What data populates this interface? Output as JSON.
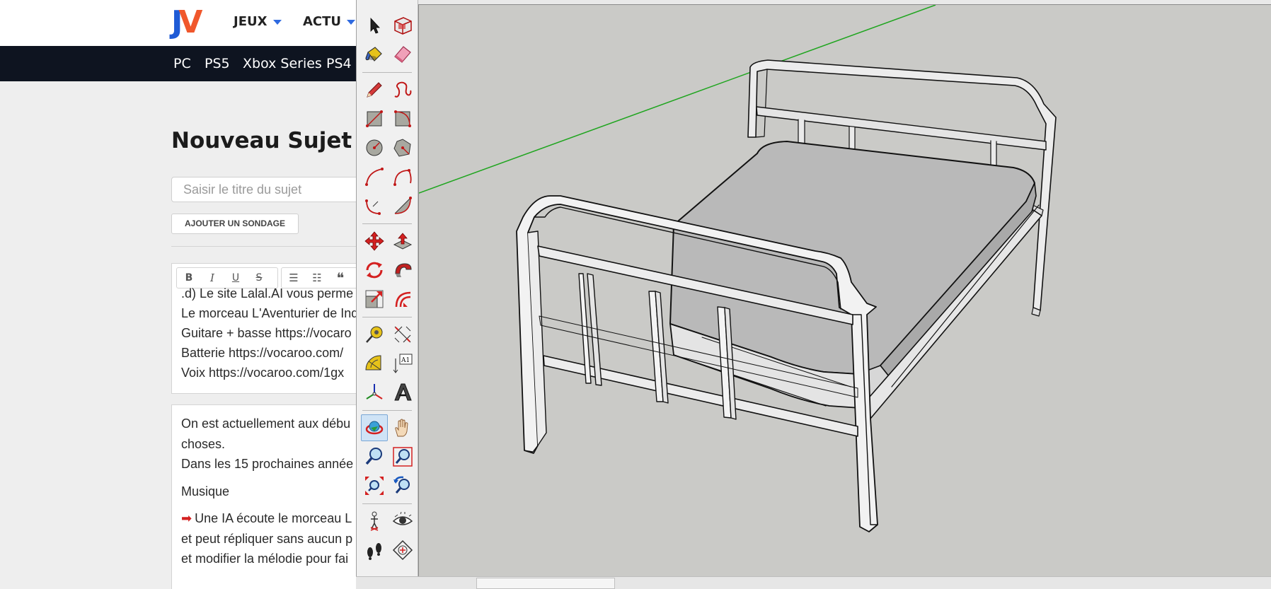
{
  "site": {
    "logo_j": "J",
    "logo_v": "V",
    "menu": [
      {
        "label": "JEUX"
      },
      {
        "label": "ACTU"
      }
    ],
    "platforms": [
      "PC",
      "PS5",
      "Xbox Series",
      "PS4"
    ]
  },
  "form": {
    "page_title": "Nouveau Sujet",
    "title_placeholder": "Saisir le titre du sujet",
    "poll_button": "AJOUTER UN SONDAGE"
  },
  "editor": {
    "toolbar": {
      "bold": "B",
      "italic": "I",
      "underline": "U",
      "strike": "S",
      "bullets": "☰",
      "numbered": "☷",
      "quote": "❝"
    },
    "lines": [
      ".d) Le site Lalal.AI vous perme",
      "Le morceau L'Aventurier de Ind",
      "Guitare + basse https://vocaro",
      "Batterie https://vocaroo.com/",
      "Voix https://vocaroo.com/1gx"
    ]
  },
  "preview": {
    "p1_line1": "On est actuellement aux débu",
    "p1_line2": "choses.",
    "p1_line3": "Dans les 15 prochaines année",
    "heading": "Musique",
    "p2_line1": "Une IA écoute le morceau L",
    "p2_line2": "et peut répliquer sans aucun p",
    "p2_line3": "et modifier la mélodie pour fai"
  },
  "sketchup": {
    "active_tool": "orbit",
    "tools": [
      "select",
      "make-component",
      "paint-bucket",
      "eraser",
      "line",
      "freehand",
      "rectangle",
      "rotated-rectangle",
      "circle",
      "polygon",
      "arc",
      "pie-arc",
      "two-point-arc",
      "three-point-arc",
      "move",
      "push-pull",
      "rotate",
      "follow-me",
      "scale",
      "offset",
      "tape-measure",
      "dimension",
      "protractor",
      "text",
      "axes",
      "3d-text",
      "orbit",
      "pan",
      "zoom",
      "zoom-window",
      "zoom-extents",
      "previous-view",
      "position-camera",
      "look-around",
      "walk",
      "section-plane"
    ],
    "text_tool_label": "A1",
    "colors": {
      "viewport_bg": "#cacac7",
      "green_axis": "#1fa51f",
      "mattress": "#b9b9b9"
    },
    "model": "metal-bed"
  }
}
